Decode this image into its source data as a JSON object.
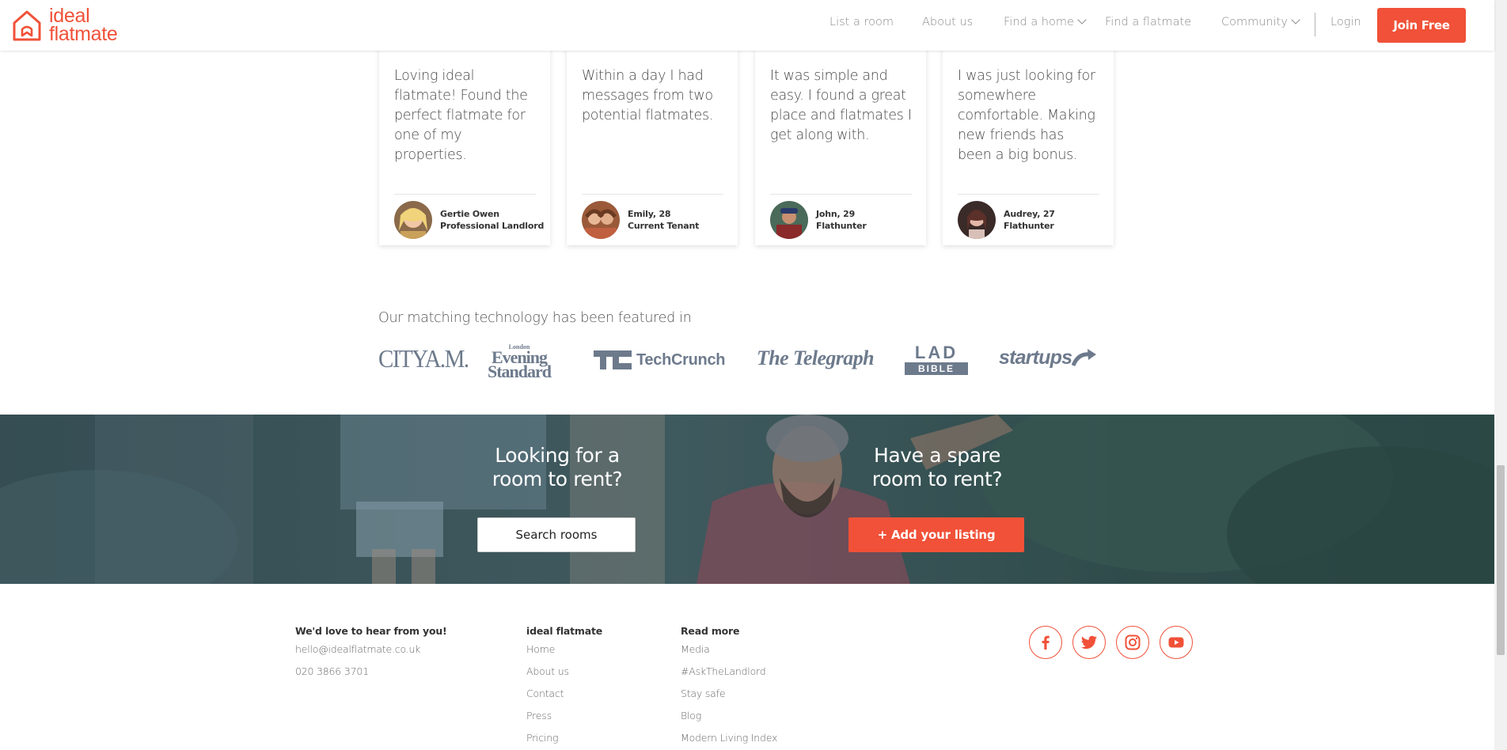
{
  "header": {
    "logo_line1": "ideal",
    "logo_line2": "flatmate",
    "nav": {
      "list_room": "List a room",
      "about": "About us",
      "find_home": "Find a home",
      "find_flatmate": "Find a flatmate",
      "community": "Community",
      "login": "Login"
    },
    "join_label": "Join Free"
  },
  "testimonials": [
    {
      "quote": "Loving ideal flatmate! Found the perfect flatmate for one of my properties.",
      "name": "Gertie Owen",
      "role": "Professional Landlord"
    },
    {
      "quote": "Within a day I had messages from two potential flatmates.",
      "name": "Emily, 28",
      "role": "Current Tenant"
    },
    {
      "quote": "It was simple and easy. I found a great place and flatmates I get along with.",
      "name": "John, 29",
      "role": "Flathunter"
    },
    {
      "quote": "I was just looking for somewhere comfortable. Making new friends has been a big bonus.",
      "name": "Audrey, 27",
      "role": "Flathunter"
    }
  ],
  "press": {
    "title": "Our matching technology has been featured in",
    "logos": {
      "cityam": "CITYA.M.",
      "es_small": "London",
      "es_1": "Evening",
      "es_2": "Standard",
      "techcrunch": "TechCrunch",
      "telegraph": "The Telegraph",
      "lad_1": "LAD",
      "lad_2": "BIBLE",
      "startups": "startups"
    }
  },
  "cta": {
    "left_heading_1": "Looking for a",
    "left_heading_2": "room to rent?",
    "left_button": "Search rooms",
    "right_heading_1": "Have a spare",
    "right_heading_2": "room to rent?",
    "right_button": "+ Add your listing"
  },
  "footer": {
    "contact_heading": "We'd love to hear from you!",
    "email": "hello@idealflatmate.co.uk",
    "phone": "020 3866 3701",
    "col2_heading": "ideal flatmate",
    "col2_links": [
      "Home",
      "About us",
      "Contact",
      "Press",
      "Pricing"
    ],
    "col3_heading": "Read more",
    "col3_links": [
      "Media",
      "#AskTheLandlord",
      "Stay safe",
      "Blog",
      "Modern Living Index"
    ]
  },
  "social_icons": [
    "facebook-icon",
    "twitter-icon",
    "instagram-icon",
    "youtube-icon"
  ],
  "colors": {
    "brand": "#f05138",
    "press_logo": "#6d7a8c",
    "banner_overlay": "#2c4a52"
  }
}
